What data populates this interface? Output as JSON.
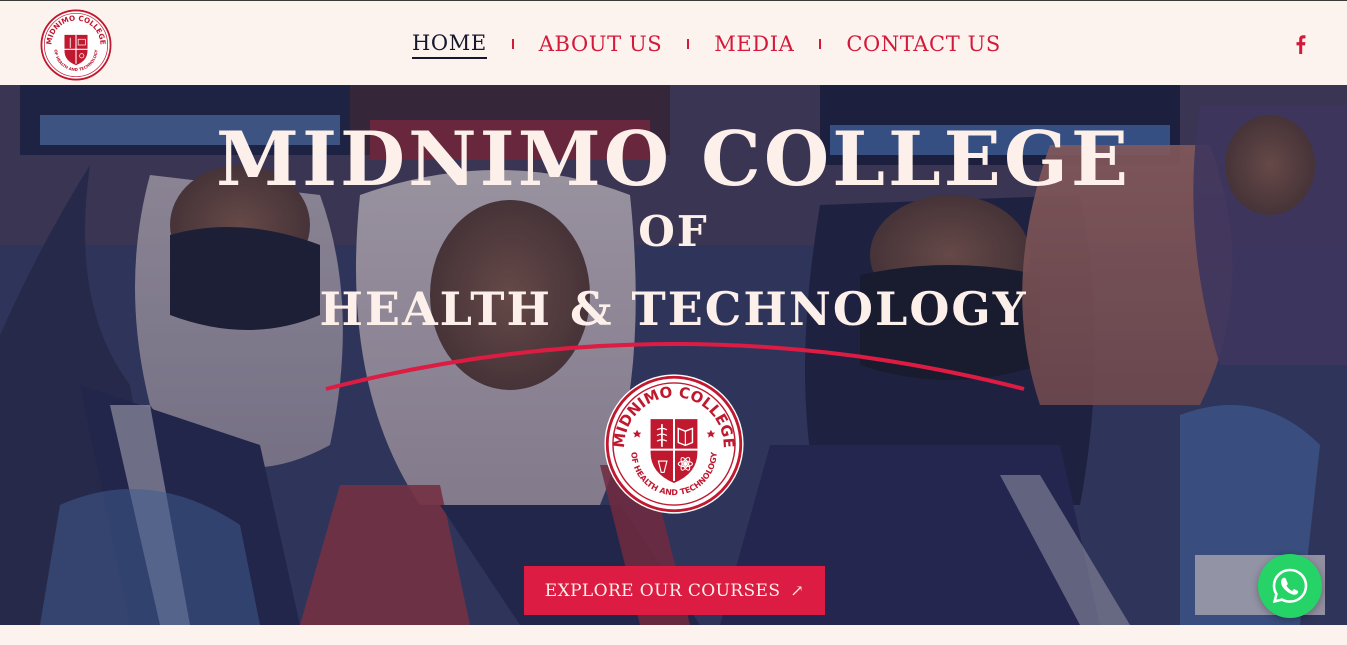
{
  "header": {
    "logo": {
      "arc_text": "MIDNIMO COLLEGE",
      "bottom_text": "OF HEALTH AND TECHNOLOGY",
      "icon": "college-crest-logo"
    },
    "nav": [
      {
        "label": "HOME",
        "active": true
      },
      {
        "label": "ABOUT US",
        "active": false
      },
      {
        "label": "MEDIA",
        "active": false
      },
      {
        "label": "CONTACT US",
        "active": false
      }
    ],
    "social_icon": "facebook-icon"
  },
  "hero": {
    "title_line_1": "MIDNIMO COLLEGE",
    "title_line_2": "OF",
    "title_line_3": "HEALTH & TECHNOLOGY",
    "logo": {
      "arc_text": "MIDNIMO COLLEGE",
      "bottom_text": "OF HEALTH AND TECHNOLOGY"
    },
    "cta_label": "EXPLORE OUR COURSES",
    "cta_icon": "arrow-up-right-icon"
  },
  "floating": {
    "whatsapp_icon": "whatsapp-icon"
  },
  "colors": {
    "brand_red": "#dc1c42",
    "nav_red": "#d4193b",
    "header_bg": "#fdf3ee",
    "active_nav": "#16172d",
    "hero_text": "#fdf0ea",
    "whatsapp_green": "#25d366"
  }
}
